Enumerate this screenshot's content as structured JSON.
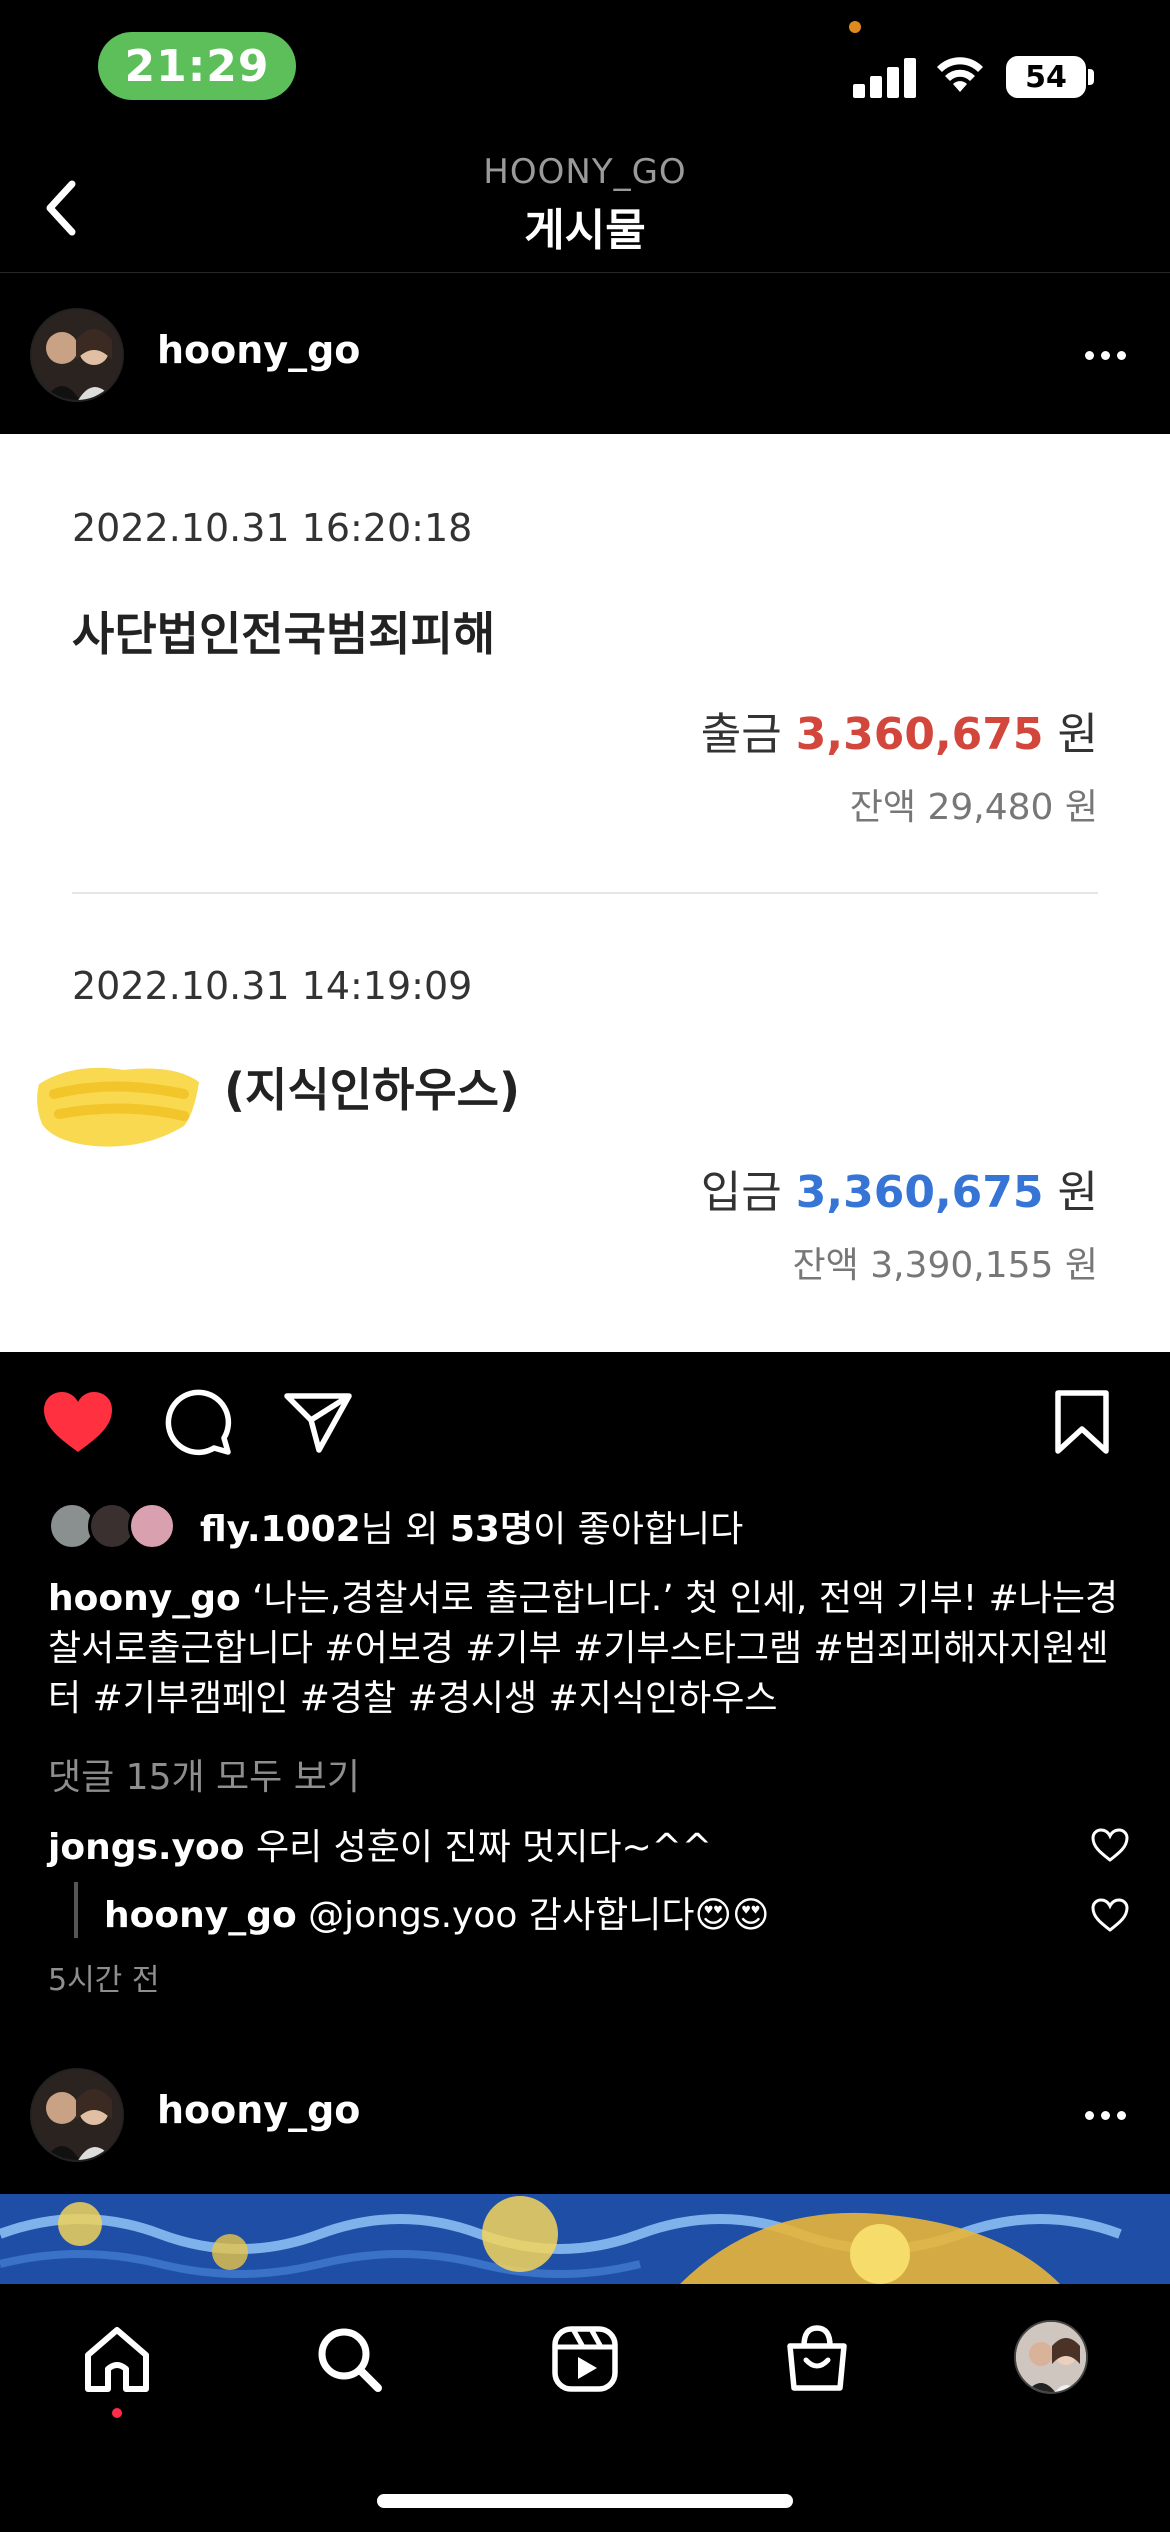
{
  "status_bar": {
    "time": "21:29",
    "battery": "54",
    "icons": [
      "signal-icon",
      "wifi-icon",
      "battery-icon"
    ]
  },
  "header": {
    "username": "HOONY_GO",
    "title": "게시물"
  },
  "post": {
    "author": "hoony_go",
    "image": {
      "transactions": [
        {
          "date": "2022.10.31 16:20:18",
          "name": "사단법인전국범죄피해",
          "type_label": "출금",
          "amount": "3,360,675",
          "unit": "원",
          "balance_label": "잔액",
          "balance": "29,480",
          "balance_unit": "원"
        },
        {
          "date": "2022.10.31 14:19:09",
          "name": "(지식인하우스)",
          "type_label": "입금",
          "amount": "3,360,675",
          "unit": "원",
          "balance_label": "잔액",
          "balance": "3,390,155",
          "balance_unit": "원"
        }
      ],
      "colors": {
        "withdraw": "#d2463c",
        "deposit": "#3674d6"
      }
    },
    "liked": true,
    "likes": {
      "user": "fly.1002",
      "suffix1": "님 외 ",
      "count": "53명",
      "suffix2": "이 좋아합니다"
    },
    "caption": {
      "user": "hoony_go",
      "text": " ‘나는,경찰서로 출근합니다.’ 첫 인세, 전액 기부! #나는경찰서로출근합니다 #어보경 #기부 #기부스타그램 #범죄피해자지원센터 #기부캠페인 #경찰 #경시생 #지식인하우스"
    },
    "view_comments": "댓글 15개 모두 보기",
    "comments": [
      {
        "user": "jongs.yoo",
        "text": " 우리 성훈이 진짜 멋지다~^^"
      },
      {
        "user": "hoony_go",
        "text": " @jongs.yoo 감사합니다😍😍"
      }
    ],
    "timestamp": "5시간 전"
  },
  "post2": {
    "author": "hoony_go"
  },
  "tab_bar": {
    "tabs": [
      "home-icon",
      "search-icon",
      "reels-icon",
      "shop-icon",
      "profile-avatar"
    ]
  },
  "accent": "#ff3040"
}
